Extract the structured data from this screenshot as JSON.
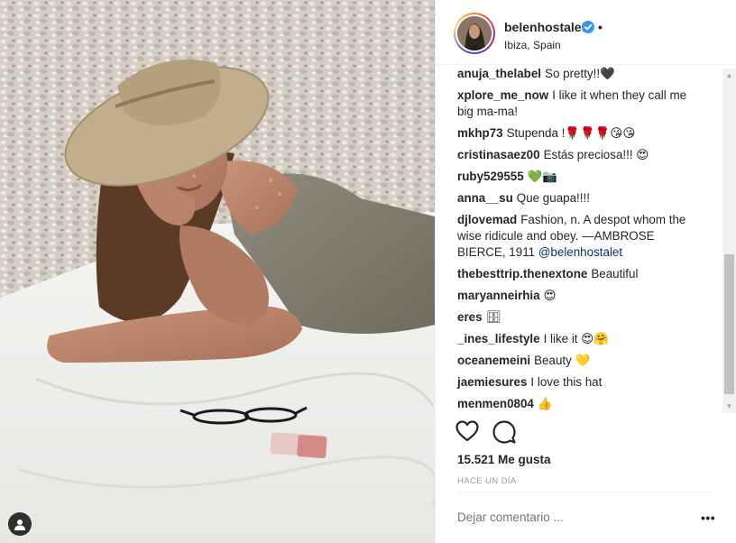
{
  "post": {
    "username": "belenhostalet",
    "separator": "•",
    "location": "Ibiza, Spain",
    "likes": "15.521 Me gusta",
    "timestamp": "HACE UN DÍA",
    "comment_placeholder": "Dejar comentario ...",
    "more_label": "•••"
  },
  "comments": [
    {
      "user": "anuja_thelabel",
      "text": "So pretty!!🖤"
    },
    {
      "user": "xplore_me_now",
      "text": "I like it when they call me big ma-ma!"
    },
    {
      "user": "mkhp73",
      "text": "Stupenda !🌹🌹🌹😘😘"
    },
    {
      "user": "cristinasaez00",
      "text": "Estás preciosa!!! 😍"
    },
    {
      "user": "ruby529555",
      "text": "💚📷"
    },
    {
      "user": "anna__su",
      "text": "Que guapa!!!!"
    },
    {
      "user": "djlovemad",
      "text": "Fashion, n. A despot whom the wise ridicule and obey. —AMBROSE BIERCE, 1911",
      "mention": "@belenhostalet"
    },
    {
      "user": "thebesttrip.thenextone",
      "text": "Beautiful"
    },
    {
      "user": "maryanneirhia",
      "text": "😍"
    },
    {
      "user": "eres",
      "text": "🗄"
    },
    {
      "user": "_ines_lifestyle",
      "text": "I like it 😍🤗"
    },
    {
      "user": "oceanemeini",
      "text": "Beauty 💛"
    },
    {
      "user": "jaemiesures",
      "text": "I love this hat"
    },
    {
      "user": "menmen0804",
      "text": "👍"
    }
  ]
}
